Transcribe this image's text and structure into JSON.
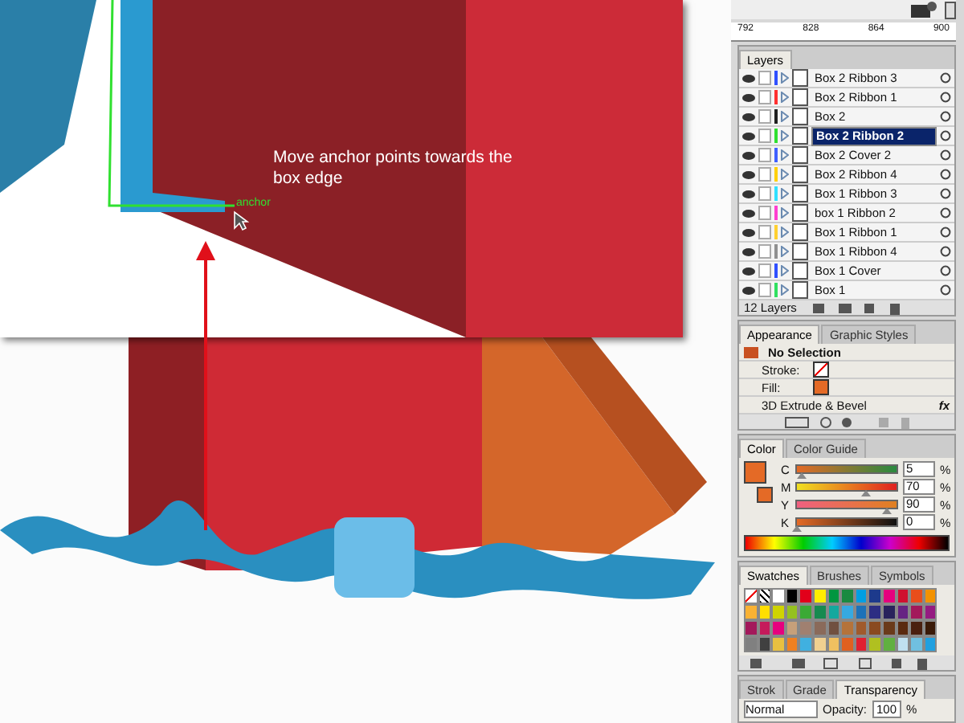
{
  "canvas": {
    "callout": "Move anchor points towards the box edge",
    "anchor_label": "anchor"
  },
  "ruler": {
    "ticks": [
      "792",
      "828",
      "864",
      "900"
    ]
  },
  "layers": {
    "tabs": [
      {
        "label": "Layers",
        "selected": true
      }
    ],
    "rows": [
      {
        "name": "Box 2 Ribbon 3",
        "color": "#3050ff",
        "selected": false
      },
      {
        "name": "Box 2 Ribbon 1",
        "color": "#ff3030",
        "selected": false
      },
      {
        "name": "Box 2",
        "color": "#202020",
        "selected": false
      },
      {
        "name": "Box 2 Ribbon 2",
        "color": "#30e030",
        "selected": true
      },
      {
        "name": "Box 2 Cover 2",
        "color": "#4060ff",
        "selected": false
      },
      {
        "name": "Box 2 Ribbon 4",
        "color": "#ffd000",
        "selected": false
      },
      {
        "name": "Box 1 Ribbon 3",
        "color": "#30e0ff",
        "selected": false
      },
      {
        "name": "box 1 Ribbon 2",
        "color": "#ff40d0",
        "selected": false
      },
      {
        "name": "Box 1 Ribbon 1",
        "color": "#ffd030",
        "selected": false
      },
      {
        "name": "Box 1 Ribbon 4",
        "color": "#909090",
        "selected": false
      },
      {
        "name": "Box 1 Cover",
        "color": "#3050ff",
        "selected": false
      },
      {
        "name": "Box 1",
        "color": "#30e060",
        "selected": false
      }
    ],
    "count": "12 Layers"
  },
  "appearance": {
    "tabs": [
      {
        "label": "Appearance",
        "selected": true
      },
      {
        "label": "Graphic Styles",
        "selected": false
      }
    ],
    "title": "No Selection",
    "stroke_label": "Stroke:",
    "fill_label": "Fill:",
    "effect": "3D Extrude & Bevel",
    "fx": "fx"
  },
  "color": {
    "tabs": [
      {
        "label": "Color",
        "selected": true
      },
      {
        "label": "Color Guide",
        "selected": false
      }
    ],
    "channels": [
      {
        "name": "C",
        "value": "5",
        "unit": "%",
        "level": 0.05
      },
      {
        "name": "M",
        "value": "70",
        "unit": "%",
        "level": 0.7
      },
      {
        "name": "Y",
        "value": "90",
        "unit": "%",
        "level": 0.9
      },
      {
        "name": "K",
        "value": "0",
        "unit": "%",
        "level": 0.0
      }
    ]
  },
  "swatches": {
    "tabs": [
      {
        "label": "Swatches",
        "selected": true
      },
      {
        "label": "Brushes",
        "selected": false
      },
      {
        "label": "Symbols",
        "selected": false
      }
    ],
    "items": [
      {
        "kind": "none"
      },
      {
        "kind": "registration"
      },
      {
        "kind": "color",
        "color": "#ffffff"
      },
      {
        "kind": "color",
        "color": "#000000"
      },
      {
        "kind": "color",
        "color": "#e2001a"
      },
      {
        "kind": "color",
        "color": "#ffed00"
      },
      {
        "kind": "color",
        "color": "#009640"
      },
      {
        "kind": "color",
        "color": "#1a8a40"
      },
      {
        "kind": "color",
        "color": "#009fe3"
      },
      {
        "kind": "color",
        "color": "#1d3a8c"
      },
      {
        "kind": "color",
        "color": "#e5007e"
      },
      {
        "kind": "color",
        "color": "#d01030"
      },
      {
        "kind": "color",
        "color": "#e94e1b"
      },
      {
        "kind": "color",
        "color": "#f39200"
      },
      {
        "kind": "color",
        "color": "#f9b233"
      },
      {
        "kind": "color",
        "color": "#ffde00"
      },
      {
        "kind": "color",
        "color": "#cfd300"
      },
      {
        "kind": "color",
        "color": "#95c11f"
      },
      {
        "kind": "color",
        "color": "#3aaa35"
      },
      {
        "kind": "color",
        "color": "#168a50"
      },
      {
        "kind": "color",
        "color": "#13a89e"
      },
      {
        "kind": "color",
        "color": "#36a9e1"
      },
      {
        "kind": "color",
        "color": "#1d71b8"
      },
      {
        "kind": "color",
        "color": "#2d2e83"
      },
      {
        "kind": "color",
        "color": "#29235c"
      },
      {
        "kind": "color",
        "color": "#662483"
      },
      {
        "kind": "color",
        "color": "#a3195b"
      },
      {
        "kind": "color",
        "color": "#951b81"
      },
      {
        "kind": "color",
        "color": "#a3195b"
      },
      {
        "kind": "color",
        "color": "#c51a5b"
      },
      {
        "kind": "color",
        "color": "#e6007e"
      },
      {
        "kind": "color",
        "color": "#c6a07a"
      },
      {
        "kind": "color",
        "color": "#a08070"
      },
      {
        "kind": "color",
        "color": "#8a6a5a"
      },
      {
        "kind": "color",
        "color": "#705040"
      },
      {
        "kind": "color",
        "color": "#b5733a"
      },
      {
        "kind": "color",
        "color": "#a05a2c"
      },
      {
        "kind": "color",
        "color": "#8a4a20"
      },
      {
        "kind": "color",
        "color": "#6a3a1a"
      },
      {
        "kind": "color",
        "color": "#5a2a10"
      },
      {
        "kind": "color",
        "color": "#4a2010"
      },
      {
        "kind": "color",
        "color": "#3a1a08"
      },
      {
        "kind": "color",
        "color": "#808080"
      },
      {
        "kind": "color",
        "color": "#404040"
      },
      {
        "kind": "color",
        "color": "#e8c040"
      },
      {
        "kind": "color",
        "color": "#f08020"
      },
      {
        "kind": "color",
        "color": "#40b0e0"
      },
      {
        "kind": "color",
        "color": "#f0d090"
      },
      {
        "kind": "color",
        "color": "#f0c060"
      },
      {
        "kind": "color",
        "color": "#e06020"
      },
      {
        "kind": "color",
        "color": "#e02030"
      },
      {
        "kind": "color",
        "color": "#b0c020"
      },
      {
        "kind": "color",
        "color": "#60b040"
      },
      {
        "kind": "color",
        "color": "#c0e0f0"
      },
      {
        "kind": "color",
        "color": "#70c0e0"
      },
      {
        "kind": "color",
        "color": "#20a0e0"
      }
    ]
  },
  "transparency": {
    "tabs": [
      {
        "label": "Strok",
        "selected": false
      },
      {
        "label": "Grade",
        "selected": false
      },
      {
        "label": "Transparency",
        "selected": true
      }
    ],
    "mode": "Normal",
    "opacity_label": "Opacity:",
    "opacity": "100",
    "unit": "%"
  }
}
